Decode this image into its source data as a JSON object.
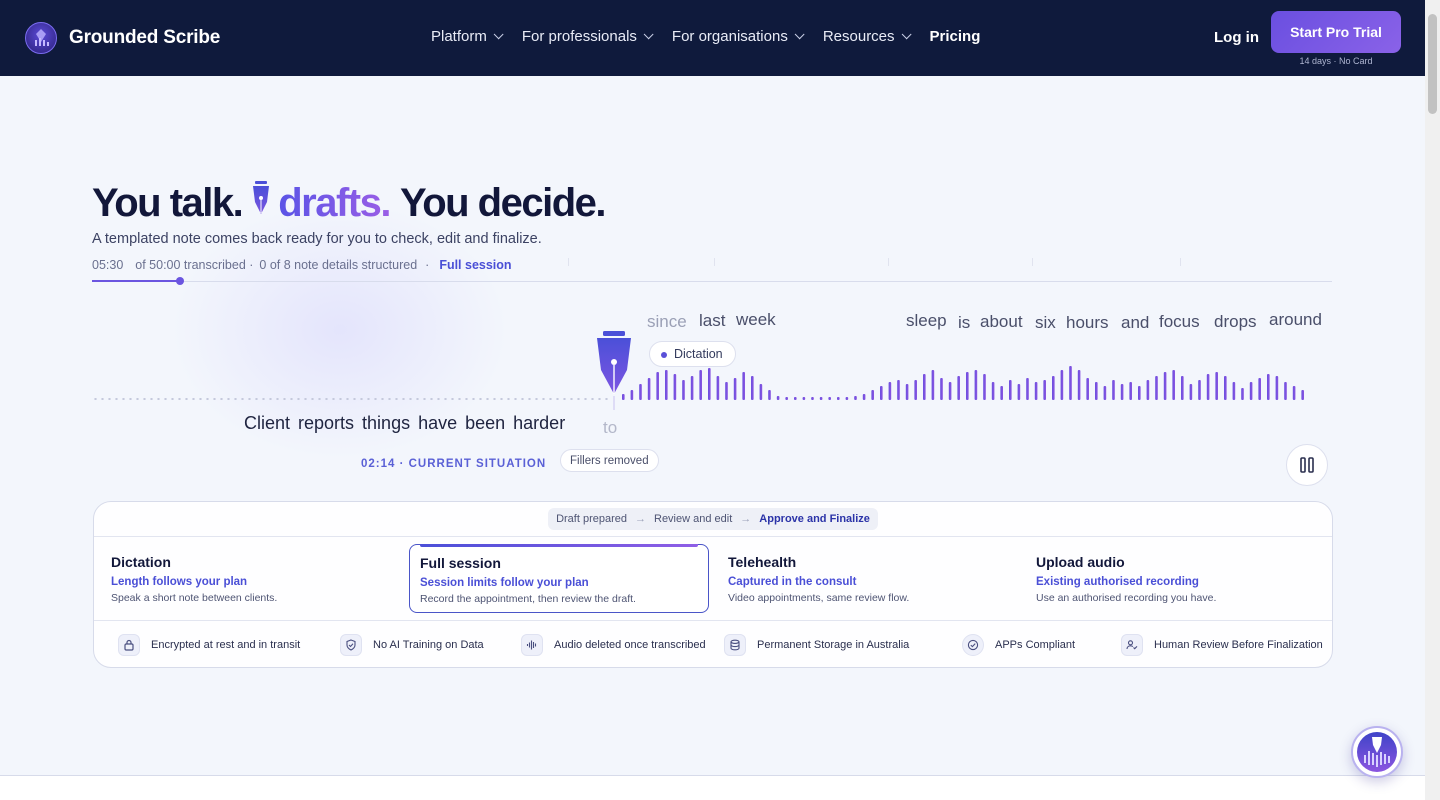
{
  "nav": {
    "brand": "Grounded Scribe",
    "menu": [
      {
        "label": "Platform"
      },
      {
        "label": "For professionals"
      },
      {
        "label": "For organisations"
      },
      {
        "label": "Resources"
      }
    ],
    "pricing": "Pricing",
    "login": "Log in",
    "trial_button": "Start Pro Trial",
    "trial_note": "14 days · No Card"
  },
  "hero": {
    "headline_a": "You talk.",
    "headline_accent": "drafts.",
    "headline_b": "You decide.",
    "subhead": "A templated note comes back ready for you to check, edit and finalize.",
    "progress": {
      "time": "05:30",
      "transcribed": "of 50:00 transcribed ·",
      "details": "0 of 8 note details structured",
      "sep": "·",
      "mode": "Full session",
      "fraction": 0.11
    },
    "words_faint": [
      "since"
    ],
    "words_top": [
      "last",
      "week",
      "sleep",
      "is",
      "about",
      "six",
      "hours",
      "and",
      "focus",
      "drops",
      "around"
    ],
    "dictation_pill": "Dictation",
    "caption": "Client reports things have been harder",
    "caption_faint": "to",
    "stamp": "02:14 · CURRENT SITUATION",
    "fillers_pill": "Fillers removed"
  },
  "card": {
    "steps": [
      "Draft prepared",
      "Review and edit",
      "Approve and Finalize"
    ],
    "arrow": "→",
    "modes": [
      {
        "title": "Dictation",
        "sub": "Length follows your plan",
        "desc": "Speak a short note between clients."
      },
      {
        "title": "Full session",
        "sub": "Session limits follow your plan",
        "desc": "Record the appointment, then review the draft."
      },
      {
        "title": "Telehealth",
        "sub": "Captured in the consult",
        "desc": "Video appointments, same review flow."
      },
      {
        "title": "Upload audio",
        "sub": "Existing authorised recording",
        "desc": "Use an authorised recording you have."
      }
    ],
    "badges": [
      {
        "label": "Encrypted at rest and in transit",
        "icon": "lock-icon"
      },
      {
        "label": "No AI Training on Data",
        "icon": "shield-icon"
      },
      {
        "label": "Audio deleted once transcribed",
        "icon": "waveform-icon"
      },
      {
        "label": "Permanent Storage in Australia",
        "icon": "database-icon"
      },
      {
        "label": "APPs Compliant",
        "icon": "check-circle-icon"
      },
      {
        "label": "Human Review Before Finalization",
        "icon": "user-check-icon"
      }
    ]
  },
  "colors": {
    "nav_bg": "#0f1a3c",
    "accent": "#6a55e0",
    "link": "#4a4fd6"
  }
}
